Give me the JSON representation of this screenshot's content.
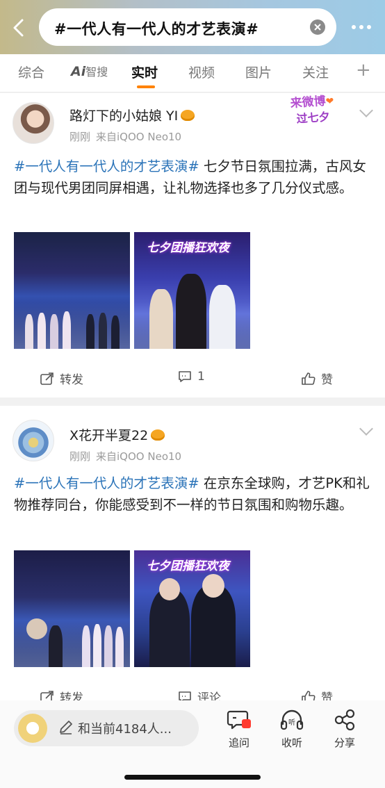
{
  "header": {
    "search_query": "#一代人有一代人的才艺表演#",
    "accent_color": "#ff8200"
  },
  "tabs": [
    {
      "label": "综合",
      "active": false
    },
    {
      "label_prefix": "Ai",
      "label": "智搜",
      "active": false
    },
    {
      "label": "实时",
      "active": true
    },
    {
      "label": "视频",
      "active": false
    },
    {
      "label": "图片",
      "active": false
    },
    {
      "label": "关注",
      "active": false
    }
  ],
  "posts": [
    {
      "username": "路灯下的小姑娘 YI",
      "time": "刚刚",
      "source": "来自iQOO Neo10",
      "sticker": {
        "line1": "来微博",
        "line2": "过七夕"
      },
      "hashtag": "#一代人有一代人的才艺表演#",
      "text": " 七夕节日氛围拉满，古风女团与现代男团同屏相遇，让礼物选择也多了几分仪式感。",
      "image_caption": "七夕团播狂欢夜",
      "actions": {
        "repost": "转发",
        "comment": "1",
        "like": "赞"
      }
    },
    {
      "username": "X花开半夏22",
      "time": "刚刚",
      "source": "来自iQOO Neo10",
      "hashtag": "#一代人有一代人的才艺表演#",
      "text": " 在京东全球购，才艺PK和礼物推荐同台，你能感受到不一样的节日氛围和购物乐趣。",
      "image_caption": "七夕团播狂欢夜",
      "actions": {
        "repost": "转发",
        "comment": "评论",
        "like": "赞"
      }
    }
  ],
  "bottom_bar": {
    "input_placeholder": "和当前4184人...",
    "ask": "追问",
    "listen": "收听",
    "share": "分享"
  }
}
